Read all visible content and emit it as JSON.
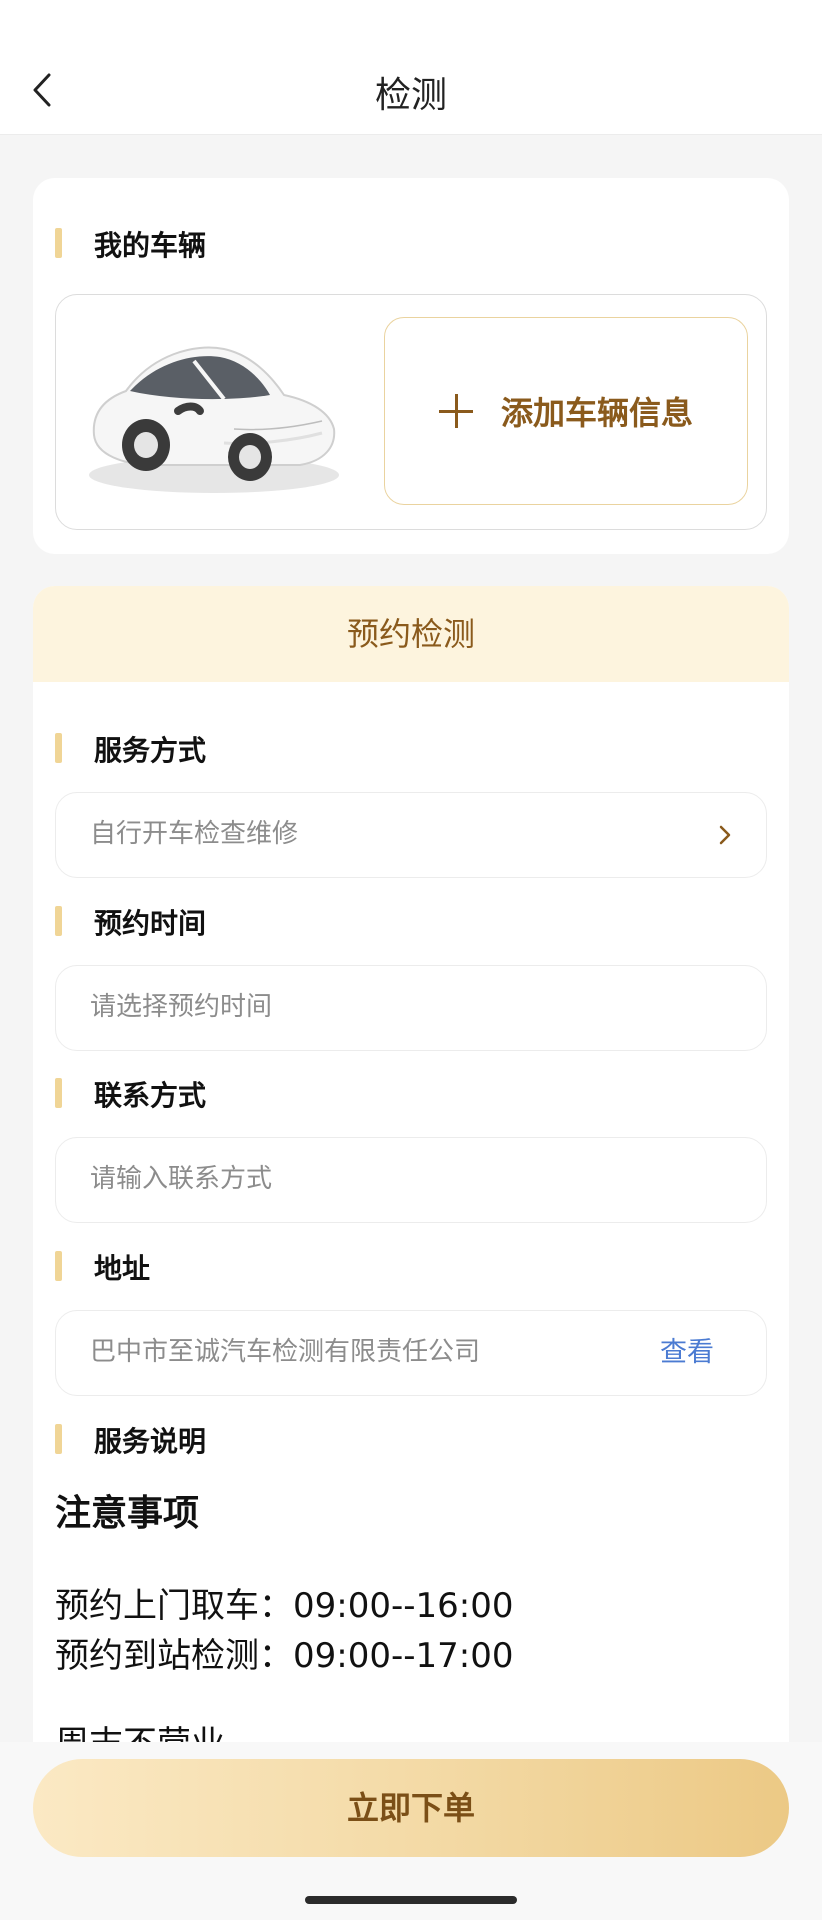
{
  "header": {
    "title": "检测"
  },
  "vehicle": {
    "section_title": "我的车辆",
    "add_label": "添加车辆信息"
  },
  "booking": {
    "header": "预约检测",
    "service_method": {
      "label": "服务方式",
      "value": "自行开车检查维修"
    },
    "appointment_time": {
      "label": "预约时间",
      "placeholder": "请选择预约时间"
    },
    "contact": {
      "label": "联系方式",
      "placeholder": "请输入联系方式"
    },
    "address": {
      "label": "地址",
      "value": "巴中市至诚汽车检测有限责任公司",
      "link": "查看"
    },
    "service_desc": {
      "label": "服务说明"
    },
    "notes": {
      "heading": "注意事项",
      "lines": [
        "预约上门取车：09:00--16:00",
        "预约到站检测：09:00--17:00",
        "周末不营业"
      ]
    }
  },
  "footer": {
    "submit_label": "立即下单"
  },
  "colors": {
    "accent": "#f0d596",
    "brand_text": "#8a5a1c",
    "link": "#4b7bd2"
  }
}
